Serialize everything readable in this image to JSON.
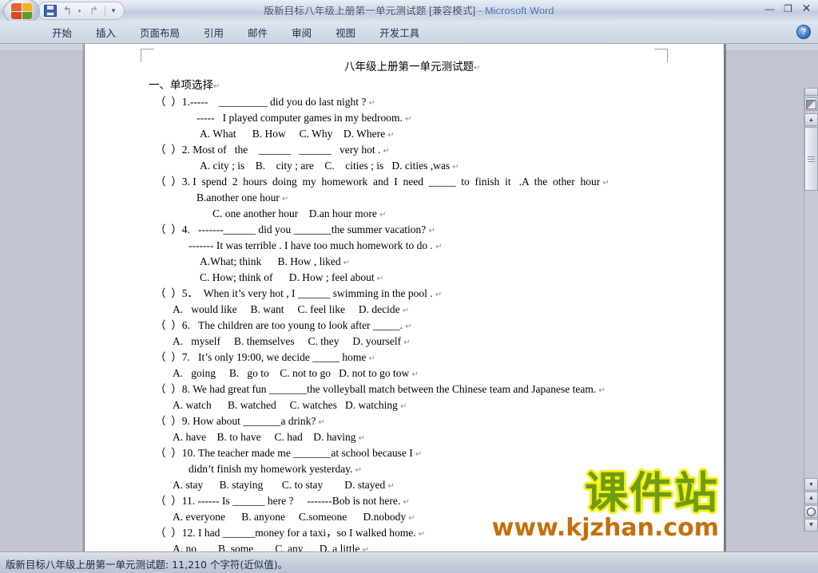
{
  "window": {
    "title": "版新目标八年级上册第一单元测试题 [兼容模式] - Microsoft Word",
    "title_doc": "版新目标八年级上册第一单元测试题 [兼容模式]",
    "title_sep": " - ",
    "title_app": "Microsoft Word",
    "minimize": "—",
    "restore": "❐",
    "close": "✕"
  },
  "quick_access": {
    "office_button": "Office",
    "save": "save-icon",
    "undo": "↰",
    "undo_caret": "▾",
    "redo": "↱",
    "customize": "▾"
  },
  "ribbon": {
    "tabs": [
      {
        "label": "开始"
      },
      {
        "label": "插入"
      },
      {
        "label": "页面布局"
      },
      {
        "label": "引用"
      },
      {
        "label": "邮件"
      },
      {
        "label": "审阅"
      },
      {
        "label": "视图"
      },
      {
        "label": "开发工具"
      }
    ],
    "help": "?"
  },
  "document": {
    "title_line": "八年级上册第一单元测试题",
    "section_heading": "一、单项选择",
    "lines": [
      {
        "indent": 88,
        "text": "（  ）1.-----    _________ did you do last night ?"
      },
      {
        "indent": 140,
        "text": "-----   I played computer games in my bedroom."
      },
      {
        "indent": 144,
        "text": "A. What      B. How     C. Why    D. Where"
      },
      {
        "indent": 88,
        "text": "（  ）2. Most of   the    ______   ______   very hot ."
      },
      {
        "indent": 144,
        "text": "A. city ; is    B.    city ; are    C.    cities ; is   D. cities ,was"
      },
      {
        "indent": 88,
        "text": "（  ）3. I  spend  2  hours  doing  my  homework  and  I  need  _____  to  finish  it   .A  the  other  hour"
      },
      {
        "indent": 140,
        "text": "B.another one hour"
      },
      {
        "indent": 160,
        "text": "C. one another hour    D.an hour more"
      },
      {
        "indent": 88,
        "text": "（  ）4.   -------______ did you _______the summer vacation?"
      },
      {
        "indent": 130,
        "text": "------- It was terrible . I have too much homework to do ."
      },
      {
        "indent": 144,
        "text": "A.What; think      B. How , liked"
      },
      {
        "indent": 144,
        "text": "C. How; think of      D. How ; feel about"
      },
      {
        "indent": 88,
        "text": "（  ）5．  When it’s very hot , I ______ swimming in the pool ."
      },
      {
        "indent": 110,
        "text": "A.   would like     B. want     C. feel like     D. decide"
      },
      {
        "indent": 88,
        "text": "（  ）6.   The children are too young to look after _____."
      },
      {
        "indent": 110,
        "text": "A.   myself     B. themselves     C. they     D. yourself"
      },
      {
        "indent": 88,
        "text": "（  ）7.   It’s only 19:00, we decide _____ home"
      },
      {
        "indent": 110,
        "text": "A.   going     B.   go to    C. not to go   D. not to go tow"
      },
      {
        "indent": 88,
        "text": "（  ）8. We had great fun _______the volleyball match between the Chinese team and Japanese team."
      },
      {
        "indent": 110,
        "text": "A. watch      B. watched     C. watches   D. watching"
      },
      {
        "indent": 88,
        "text": "（  ）9. How about _______a drink?"
      },
      {
        "indent": 110,
        "text": "A. have    B. to have     C. had    D. having"
      },
      {
        "indent": 88,
        "text": "（  ）10. The teacher made me _______at school because I"
      },
      {
        "indent": 130,
        "text": "didn’t finish my homework yesterday."
      },
      {
        "indent": 110,
        "text": "A. stay      B. staying       C. to stay        D. stayed"
      },
      {
        "indent": 88,
        "text": "（  ）11. ------ Is ______ here ?     -------Bob is not here."
      },
      {
        "indent": 110,
        "text": "A. everyone      B. anyone     C.someone      D.nobody"
      },
      {
        "indent": 88,
        "text": "（  ）12. I had ______money for a taxi，so I walked home."
      },
      {
        "indent": 110,
        "text": "A. no        B. some        C. any      D. a little"
      }
    ],
    "paragraph_mark": "↵"
  },
  "watermark": {
    "main": "课件站",
    "sub": "www.kjzhan.com",
    "main_color": "#6f9c10",
    "outline_color": "#f6ef1a",
    "sub_color": "#c4700c"
  },
  "scrollbar": {
    "up_arrow": "▲",
    "down_arrow": "▼",
    "prev_page": "⯅",
    "select_browse_object": "◉",
    "next_page": "⯆"
  },
  "status": {
    "text": "版新目标八年级上册第一单元测试题: 11,210 个字符(近似值)。"
  }
}
